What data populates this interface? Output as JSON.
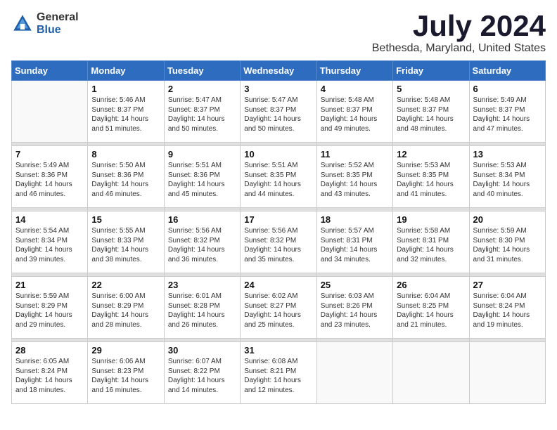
{
  "logo": {
    "general": "General",
    "blue": "Blue"
  },
  "title": "July 2024",
  "location": "Bethesda, Maryland, United States",
  "days_header": [
    "Sunday",
    "Monday",
    "Tuesday",
    "Wednesday",
    "Thursday",
    "Friday",
    "Saturday"
  ],
  "weeks": [
    [
      {
        "day": "",
        "info": ""
      },
      {
        "day": "1",
        "info": "Sunrise: 5:46 AM\nSunset: 8:37 PM\nDaylight: 14 hours\nand 51 minutes."
      },
      {
        "day": "2",
        "info": "Sunrise: 5:47 AM\nSunset: 8:37 PM\nDaylight: 14 hours\nand 50 minutes."
      },
      {
        "day": "3",
        "info": "Sunrise: 5:47 AM\nSunset: 8:37 PM\nDaylight: 14 hours\nand 50 minutes."
      },
      {
        "day": "4",
        "info": "Sunrise: 5:48 AM\nSunset: 8:37 PM\nDaylight: 14 hours\nand 49 minutes."
      },
      {
        "day": "5",
        "info": "Sunrise: 5:48 AM\nSunset: 8:37 PM\nDaylight: 14 hours\nand 48 minutes."
      },
      {
        "day": "6",
        "info": "Sunrise: 5:49 AM\nSunset: 8:37 PM\nDaylight: 14 hours\nand 47 minutes."
      }
    ],
    [
      {
        "day": "7",
        "info": "Sunrise: 5:49 AM\nSunset: 8:36 PM\nDaylight: 14 hours\nand 46 minutes."
      },
      {
        "day": "8",
        "info": "Sunrise: 5:50 AM\nSunset: 8:36 PM\nDaylight: 14 hours\nand 46 minutes."
      },
      {
        "day": "9",
        "info": "Sunrise: 5:51 AM\nSunset: 8:36 PM\nDaylight: 14 hours\nand 45 minutes."
      },
      {
        "day": "10",
        "info": "Sunrise: 5:51 AM\nSunset: 8:35 PM\nDaylight: 14 hours\nand 44 minutes."
      },
      {
        "day": "11",
        "info": "Sunrise: 5:52 AM\nSunset: 8:35 PM\nDaylight: 14 hours\nand 43 minutes."
      },
      {
        "day": "12",
        "info": "Sunrise: 5:53 AM\nSunset: 8:35 PM\nDaylight: 14 hours\nand 41 minutes."
      },
      {
        "day": "13",
        "info": "Sunrise: 5:53 AM\nSunset: 8:34 PM\nDaylight: 14 hours\nand 40 minutes."
      }
    ],
    [
      {
        "day": "14",
        "info": "Sunrise: 5:54 AM\nSunset: 8:34 PM\nDaylight: 14 hours\nand 39 minutes."
      },
      {
        "day": "15",
        "info": "Sunrise: 5:55 AM\nSunset: 8:33 PM\nDaylight: 14 hours\nand 38 minutes."
      },
      {
        "day": "16",
        "info": "Sunrise: 5:56 AM\nSunset: 8:32 PM\nDaylight: 14 hours\nand 36 minutes."
      },
      {
        "day": "17",
        "info": "Sunrise: 5:56 AM\nSunset: 8:32 PM\nDaylight: 14 hours\nand 35 minutes."
      },
      {
        "day": "18",
        "info": "Sunrise: 5:57 AM\nSunset: 8:31 PM\nDaylight: 14 hours\nand 34 minutes."
      },
      {
        "day": "19",
        "info": "Sunrise: 5:58 AM\nSunset: 8:31 PM\nDaylight: 14 hours\nand 32 minutes."
      },
      {
        "day": "20",
        "info": "Sunrise: 5:59 AM\nSunset: 8:30 PM\nDaylight: 14 hours\nand 31 minutes."
      }
    ],
    [
      {
        "day": "21",
        "info": "Sunrise: 5:59 AM\nSunset: 8:29 PM\nDaylight: 14 hours\nand 29 minutes."
      },
      {
        "day": "22",
        "info": "Sunrise: 6:00 AM\nSunset: 8:29 PM\nDaylight: 14 hours\nand 28 minutes."
      },
      {
        "day": "23",
        "info": "Sunrise: 6:01 AM\nSunset: 8:28 PM\nDaylight: 14 hours\nand 26 minutes."
      },
      {
        "day": "24",
        "info": "Sunrise: 6:02 AM\nSunset: 8:27 PM\nDaylight: 14 hours\nand 25 minutes."
      },
      {
        "day": "25",
        "info": "Sunrise: 6:03 AM\nSunset: 8:26 PM\nDaylight: 14 hours\nand 23 minutes."
      },
      {
        "day": "26",
        "info": "Sunrise: 6:04 AM\nSunset: 8:25 PM\nDaylight: 14 hours\nand 21 minutes."
      },
      {
        "day": "27",
        "info": "Sunrise: 6:04 AM\nSunset: 8:24 PM\nDaylight: 14 hours\nand 19 minutes."
      }
    ],
    [
      {
        "day": "28",
        "info": "Sunrise: 6:05 AM\nSunset: 8:24 PM\nDaylight: 14 hours\nand 18 minutes."
      },
      {
        "day": "29",
        "info": "Sunrise: 6:06 AM\nSunset: 8:23 PM\nDaylight: 14 hours\nand 16 minutes."
      },
      {
        "day": "30",
        "info": "Sunrise: 6:07 AM\nSunset: 8:22 PM\nDaylight: 14 hours\nand 14 minutes."
      },
      {
        "day": "31",
        "info": "Sunrise: 6:08 AM\nSunset: 8:21 PM\nDaylight: 14 hours\nand 12 minutes."
      },
      {
        "day": "",
        "info": ""
      },
      {
        "day": "",
        "info": ""
      },
      {
        "day": "",
        "info": ""
      }
    ]
  ]
}
